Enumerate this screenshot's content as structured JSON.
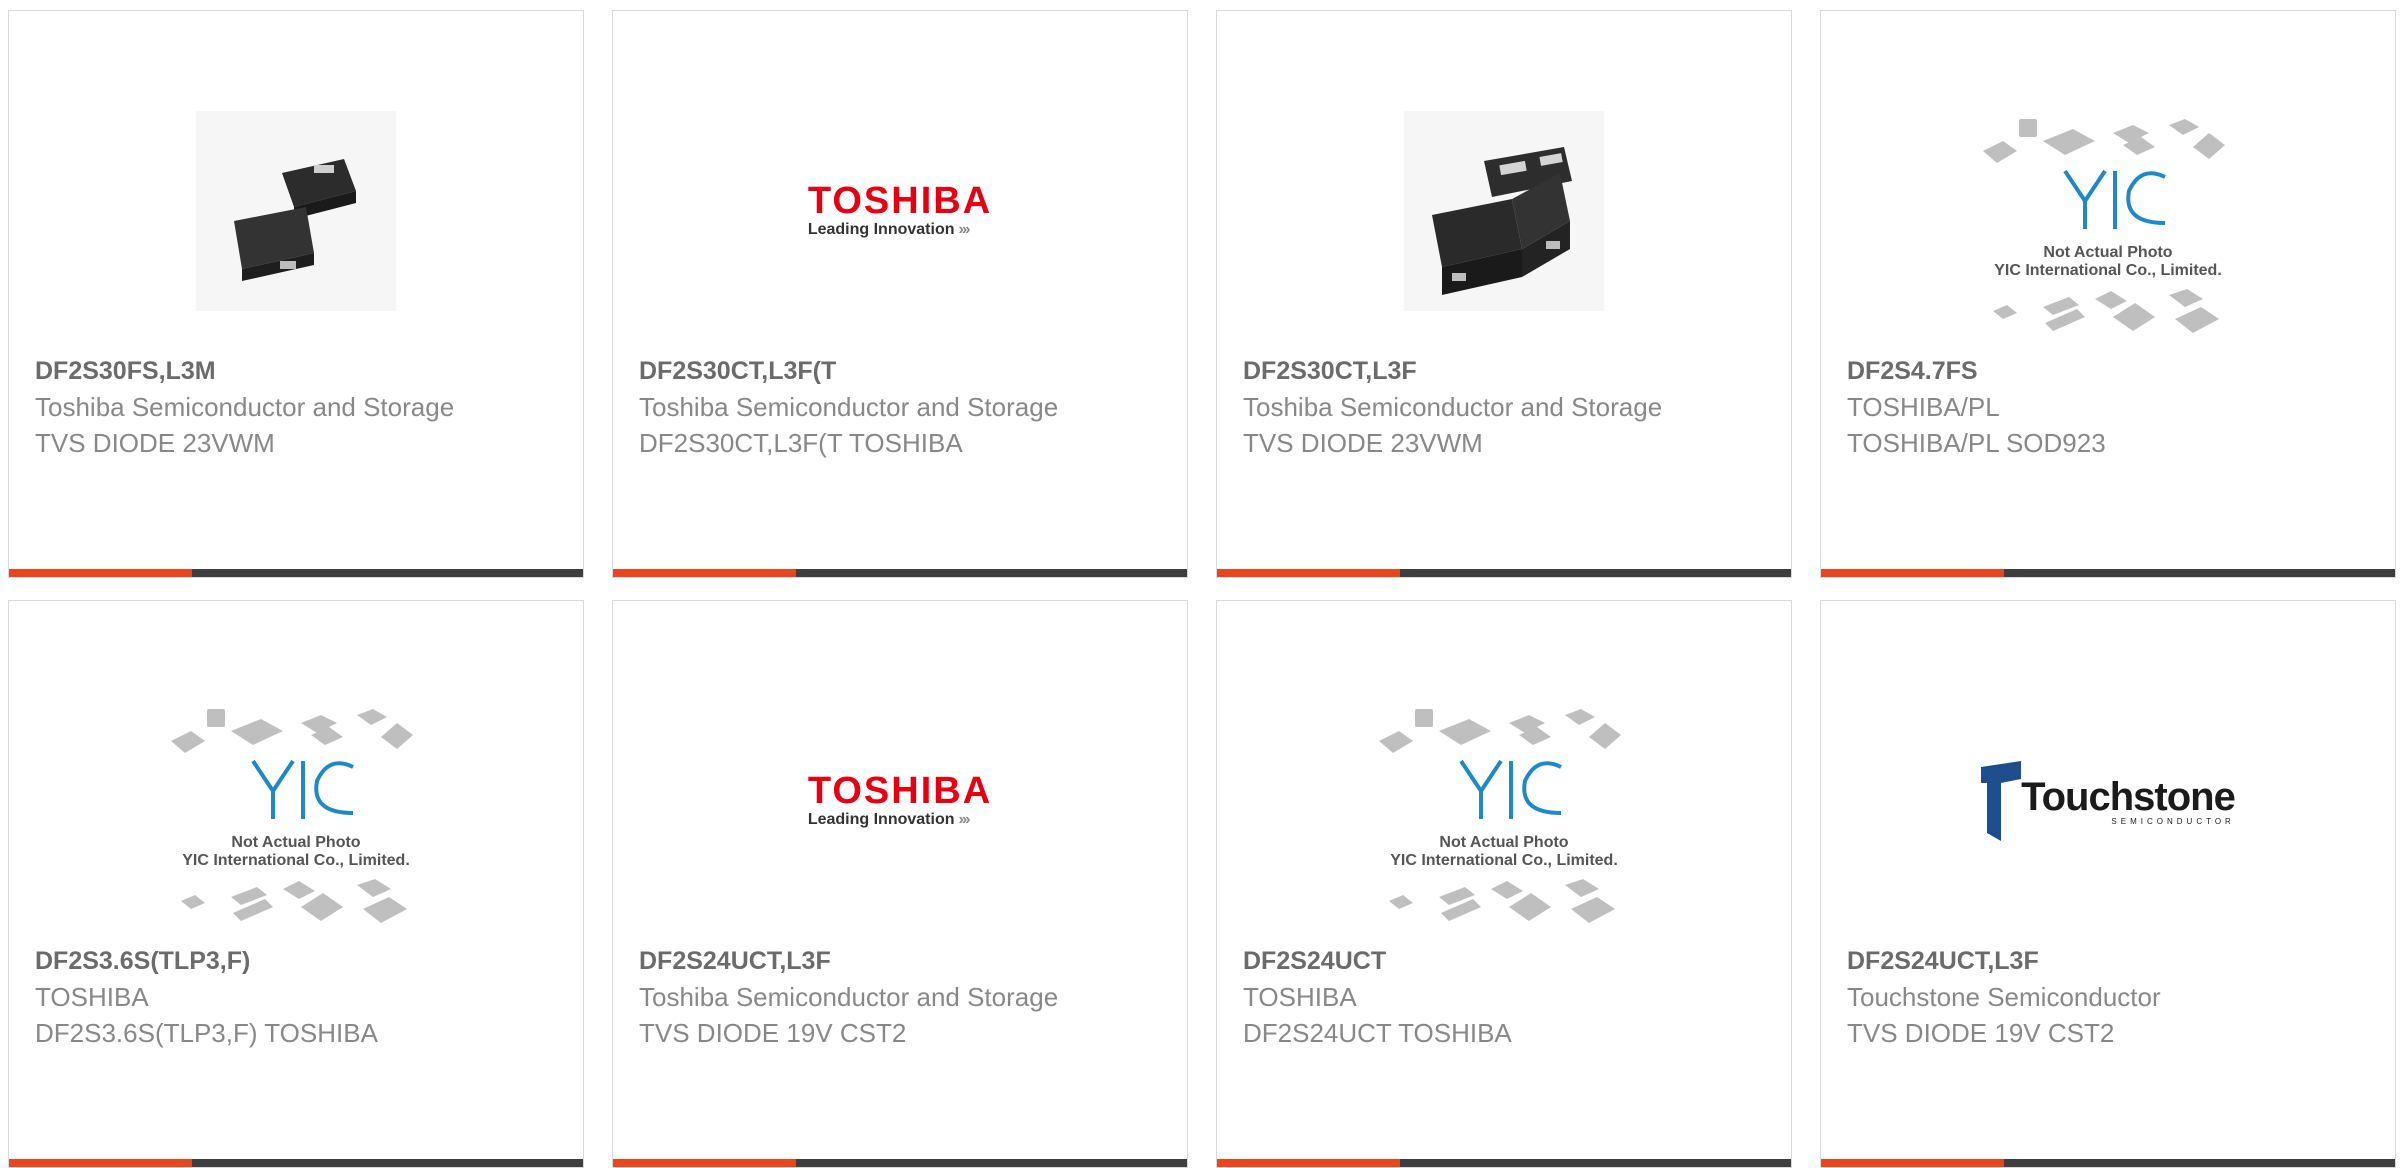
{
  "products": [
    {
      "part_number": "DF2S30FS,L3M",
      "manufacturer": "Toshiba Semiconductor and Storage",
      "description": "TVS DIODE 23VWM",
      "image": "sod-package-photo"
    },
    {
      "part_number": "DF2S30CT,L3F(T",
      "manufacturer": "Toshiba Semiconductor and Storage",
      "description": "DF2S30CT,L3F(T TOSHIBA",
      "image": "toshiba-logo"
    },
    {
      "part_number": "DF2S30CT,L3F",
      "manufacturer": "Toshiba Semiconductor and Storage",
      "description": "TVS DIODE 23VWM",
      "image": "cst2-package-photo"
    },
    {
      "part_number": "DF2S4.7FS",
      "manufacturer": "TOSHIBA/PL",
      "description": "TOSHIBA/PL SOD923",
      "image": "yic-placeholder"
    },
    {
      "part_number": "DF2S3.6S(TLP3,F)",
      "manufacturer": "TOSHIBA",
      "description": "DF2S3.6S(TLP3,F) TOSHIBA",
      "image": "yic-placeholder"
    },
    {
      "part_number": "DF2S24UCT,L3F",
      "manufacturer": "Toshiba Semiconductor and Storage",
      "description": "TVS DIODE 19V CST2",
      "image": "toshiba-logo"
    },
    {
      "part_number": "DF2S24UCT",
      "manufacturer": "TOSHIBA",
      "description": "DF2S24UCT TOSHIBA",
      "image": "yic-placeholder"
    },
    {
      "part_number": "DF2S24UCT,L3F",
      "manufacturer": "Touchstone Semiconductor",
      "description": "TVS DIODE 19V CST2",
      "image": "touchstone-logo"
    }
  ],
  "logos": {
    "toshiba_word": "TOSHIBA",
    "toshiba_tagline": "Leading Innovation",
    "touchstone_word": "Touchstone",
    "touchstone_sub": "SEMICONDUCTOR",
    "yic_letters": "YIC",
    "yic_caption_1": "Not Actual Photo",
    "yic_caption_2": "YIC International Co., Limited."
  },
  "colors": {
    "accent_bar": "#e8461f",
    "bar_dark": "#3e3e3e",
    "toshiba_red": "#e60012",
    "yic_blue": "#1e88c8"
  }
}
